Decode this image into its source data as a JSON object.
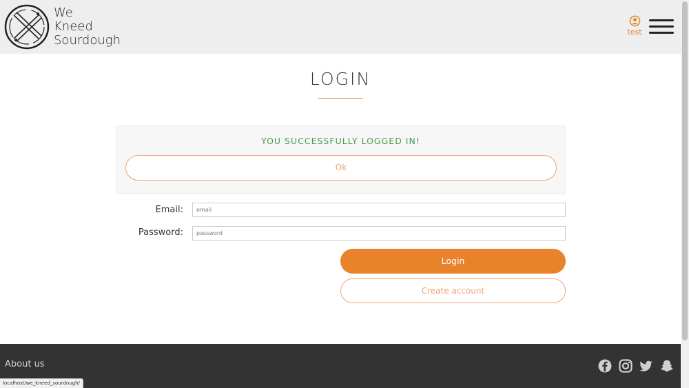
{
  "header": {
    "logo_lines": [
      "We",
      "Kneed",
      "Sourdough"
    ],
    "user_name": "test"
  },
  "main": {
    "title": "LOGIN",
    "alert": {
      "message": "YOU SUCCESSFULLY LOGGED IN!",
      "ok_label": "Ok"
    },
    "form": {
      "email_label": "Email:",
      "email_placeholder": "email",
      "email_value": "",
      "password_label": "Password:",
      "password_placeholder": "password",
      "password_value": "",
      "login_label": "Login",
      "create_account_label": "Create account"
    }
  },
  "footer": {
    "about_label": "About us",
    "social_icons": [
      "facebook-icon",
      "instagram-icon",
      "twitter-icon",
      "snapchat-icon"
    ]
  },
  "status_bar": {
    "url": "localhost/we_kneed_sourdough/"
  },
  "colors": {
    "accent": "#e8832b",
    "accent_light": "#f0a27a",
    "success": "#4a9a4a",
    "header_bg": "#eeeeee",
    "footer_bg": "#333333"
  }
}
